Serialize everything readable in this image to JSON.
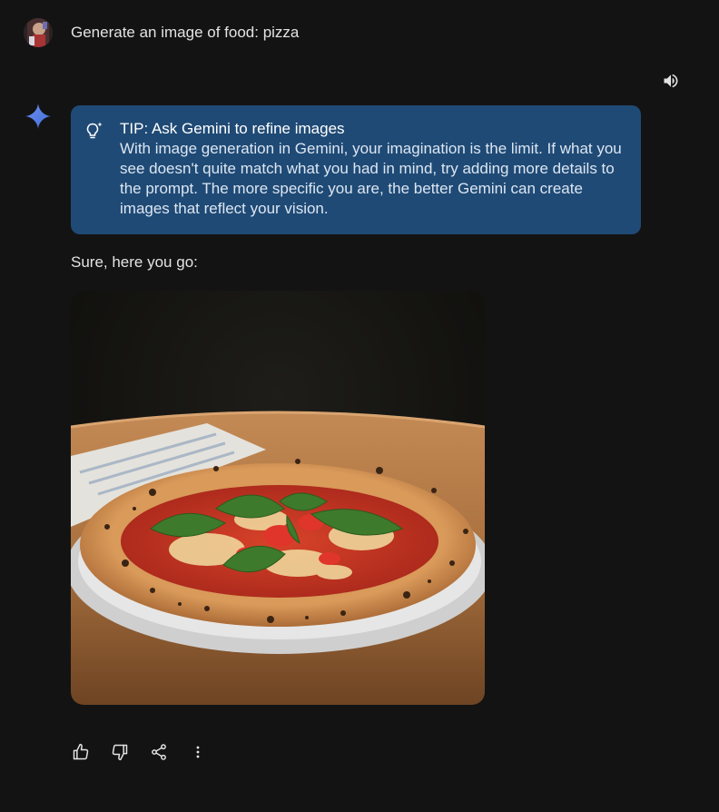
{
  "conversation": {
    "user_prompt": "Generate an image of food: pizza",
    "tip": {
      "title": "TIP: Ask Gemini to refine images",
      "body": "With image generation in Gemini, your imagination is the limit. If what you see doesn't quite match what you had in mind, try adding more details to the prompt. The more specific you are, the better Gemini can create images that reflect your vision."
    },
    "response_text": "Sure, here you go:"
  },
  "icons": {
    "speaker": "speaker-icon",
    "gemini": "gemini-spark-icon",
    "tip": "lightbulb-sparkle-icon",
    "thumbs_up": "thumbs-up-icon",
    "thumbs_down": "thumbs-down-icon",
    "share": "share-icon",
    "more": "more-vert-icon"
  },
  "colors": {
    "background": "#131314",
    "tip_card": "#1f4a75",
    "text": "#e3e3e3",
    "gemini_blue": "#4f7fe0"
  }
}
